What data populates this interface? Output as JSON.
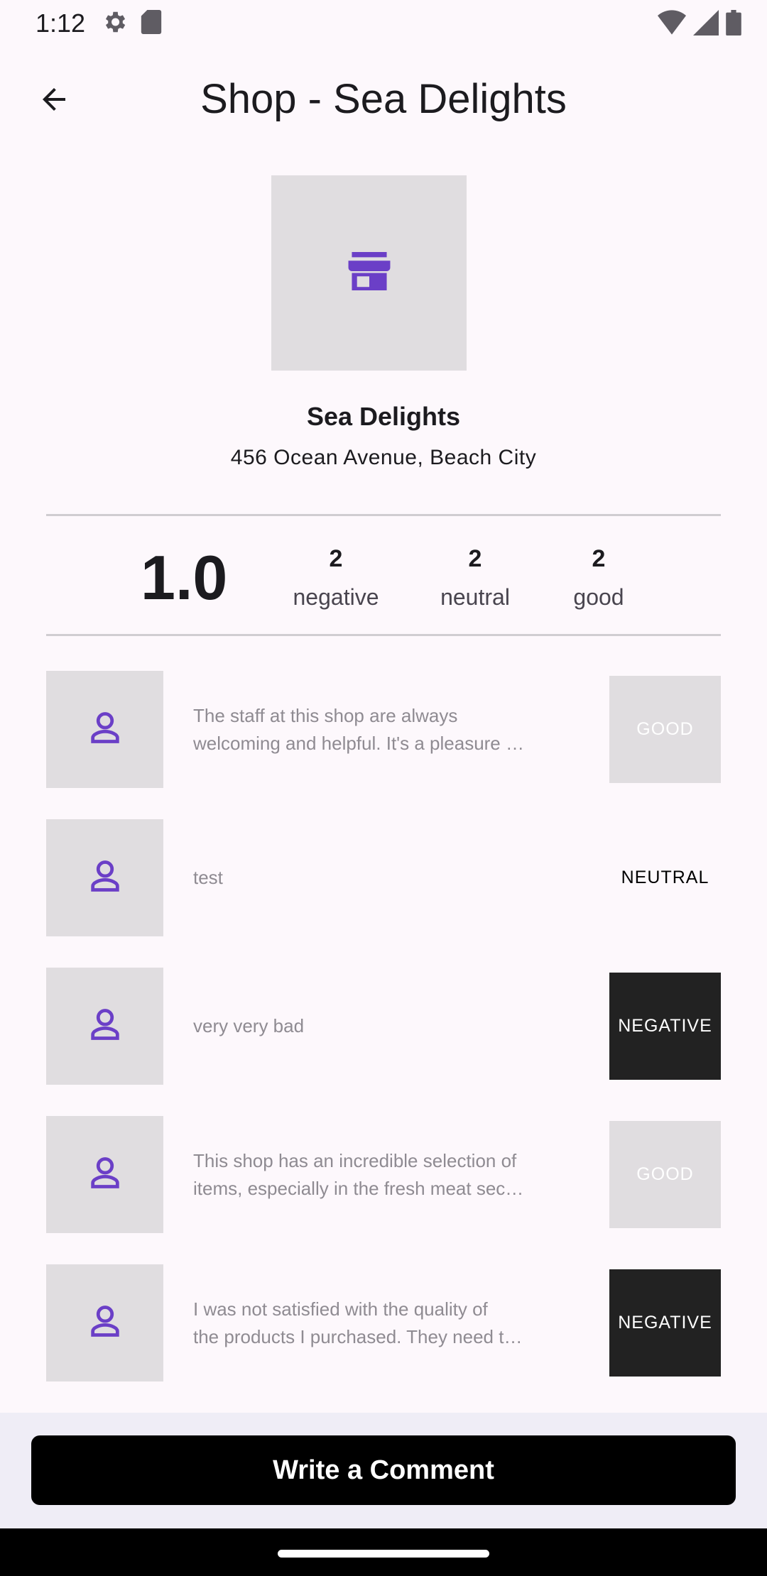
{
  "status_bar": {
    "time": "1:12",
    "icons_left": [
      "settings-gear-icon",
      "sd-card-icon"
    ],
    "icons_right": [
      "wifi-icon",
      "signal-icon",
      "battery-icon"
    ]
  },
  "app_bar": {
    "title": "Shop - Sea Delights",
    "back_icon": "arrow-back-icon"
  },
  "shop": {
    "name": "Sea Delights",
    "address": "456 Ocean Avenue, Beach City",
    "image_icon": "storefront-icon"
  },
  "stats": {
    "rating": "1.0",
    "negative": {
      "count": "2",
      "label": "negative"
    },
    "neutral": {
      "count": "2",
      "label": "neutral"
    },
    "good": {
      "count": "2",
      "label": "good"
    }
  },
  "reviews": [
    {
      "line1": "The staff at this shop are always",
      "line2": "welcoming and helpful. It's a pleasure …",
      "sentiment": "GOOD"
    },
    {
      "line1": "test",
      "sentiment": "NEUTRAL"
    },
    {
      "line1": "very very bad",
      "sentiment": "NEGATIVE"
    },
    {
      "line1": "This shop has an incredible selection of",
      "line2": "items, especially in the fresh meat sec…",
      "sentiment": "GOOD"
    },
    {
      "line1": "I was not satisfied with the quality of",
      "line2": "the products I purchased. They need t…",
      "sentiment": "NEGATIVE"
    }
  ],
  "actions": {
    "write_comment": "Write a Comment"
  },
  "colors": {
    "accent": "#6b3fc7",
    "placeholder_bg": "#e0dde0",
    "negative_badge": "#222222"
  }
}
